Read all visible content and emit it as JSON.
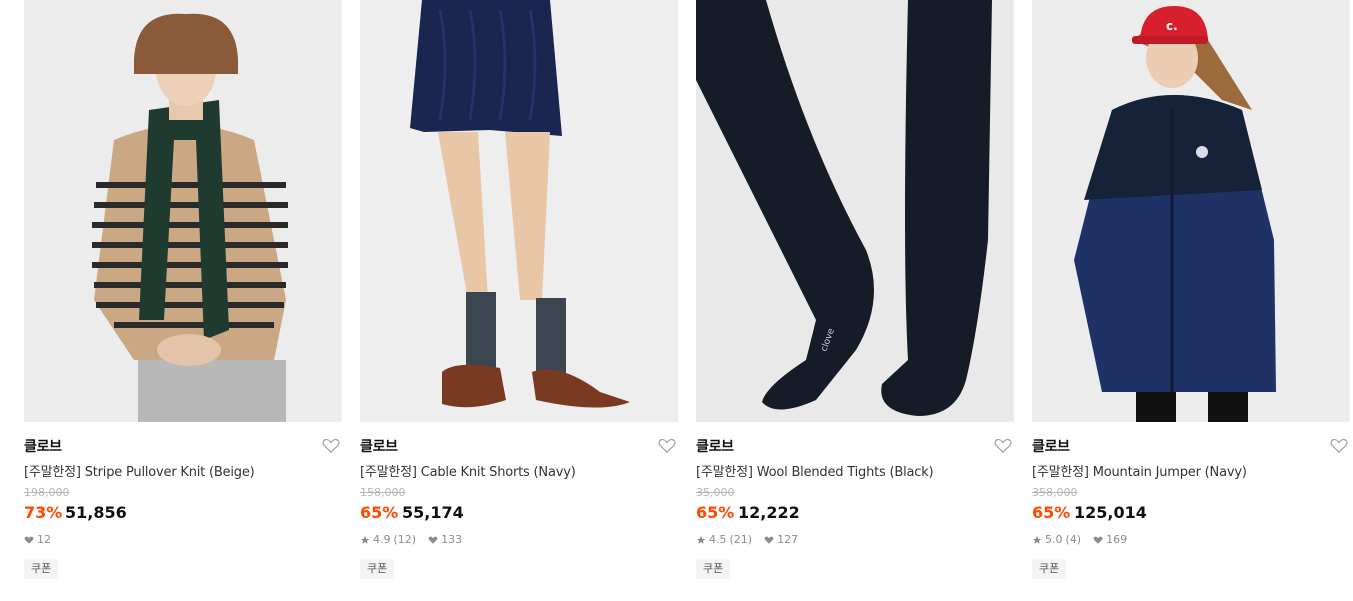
{
  "colors": {
    "discount": "#ff4800",
    "photo_bg": "#ebeaea",
    "muted": "#8c8c8c"
  },
  "products": [
    {
      "brand": "클로브",
      "name": "[주말한정] Stripe Pullover Knit (Beige)",
      "original_price": "198,000",
      "discount": "73%",
      "price": "51,856",
      "likes": "12",
      "coupon": "쿠폰",
      "icons": {
        "like": "heart-icon",
        "wish": "heart-outline-icon"
      }
    },
    {
      "brand": "클로브",
      "name": "[주말한정] Cable Knit Shorts (Navy)",
      "original_price": "158,000",
      "discount": "65%",
      "price": "55,174",
      "rating": "4.9",
      "reviews": "(12)",
      "likes": "133",
      "coupon": "쿠폰",
      "icons": {
        "rating": "star-icon",
        "like": "heart-icon",
        "wish": "heart-outline-icon"
      }
    },
    {
      "brand": "클로브",
      "name": "[주말한정] Wool Blended Tights (Black)",
      "original_price": "35,000",
      "discount": "65%",
      "price": "12,222",
      "rating": "4.5",
      "reviews": "(21)",
      "likes": "127",
      "coupon": "쿠폰",
      "icons": {
        "rating": "star-icon",
        "like": "heart-icon",
        "wish": "heart-outline-icon"
      }
    },
    {
      "brand": "클로브",
      "name": "[주말한정] Mountain Jumper (Navy)",
      "original_price": "358,000",
      "discount": "65%",
      "price": "125,014",
      "rating": "5.0",
      "reviews": "(4)",
      "likes": "169",
      "coupon": "쿠폰",
      "icons": {
        "rating": "star-icon",
        "like": "heart-icon",
        "wish": "heart-outline-icon"
      }
    }
  ]
}
